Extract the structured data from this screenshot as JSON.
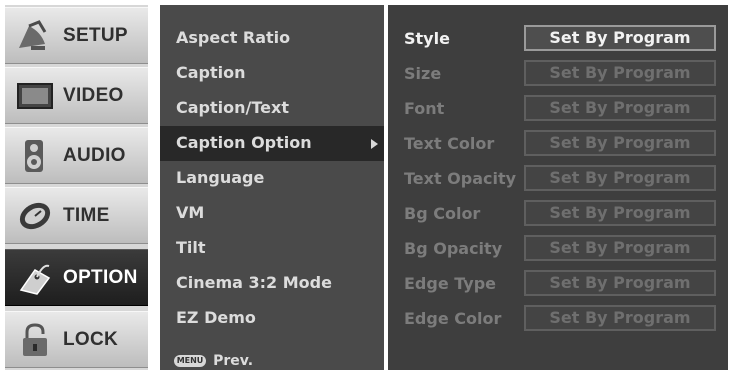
{
  "tabs": [
    {
      "label": "SETUP",
      "icon": "satellite-dish-icon",
      "active": false
    },
    {
      "label": "VIDEO",
      "icon": "monitor-icon",
      "active": false
    },
    {
      "label": "AUDIO",
      "icon": "speaker-icon",
      "active": false
    },
    {
      "label": "TIME",
      "icon": "clock-icon",
      "active": false
    },
    {
      "label": "OPTION",
      "icon": "tag-icon",
      "active": true
    },
    {
      "label": "LOCK",
      "icon": "padlock-icon",
      "active": false
    }
  ],
  "menu": {
    "items": [
      {
        "label": "Aspect Ratio",
        "selected": false
      },
      {
        "label": "Caption",
        "selected": false
      },
      {
        "label": "Caption/Text",
        "selected": false
      },
      {
        "label": "Caption Option",
        "selected": true
      },
      {
        "label": "Language",
        "selected": false
      },
      {
        "label": "VM",
        "selected": false
      },
      {
        "label": "Tilt",
        "selected": false
      },
      {
        "label": "Cinema 3:2 Mode",
        "selected": false
      },
      {
        "label": "EZ Demo",
        "selected": false
      }
    ],
    "prev_key": "MENU",
    "prev_label": "Prev."
  },
  "options": {
    "rows": [
      {
        "label": "Style",
        "value": "Set By Program",
        "active": true
      },
      {
        "label": "Size",
        "value": "Set By Program",
        "active": false
      },
      {
        "label": "Font",
        "value": "Set By Program",
        "active": false
      },
      {
        "label": "Text Color",
        "value": "Set By Program",
        "active": false
      },
      {
        "label": "Text Opacity",
        "value": "Set By Program",
        "active": false
      },
      {
        "label": "Bg Color",
        "value": "Set By Program",
        "active": false
      },
      {
        "label": "Bg Opacity",
        "value": "Set By Program",
        "active": false
      },
      {
        "label": "Edge Type",
        "value": "Set By Program",
        "active": false
      },
      {
        "label": "Edge Color",
        "value": "Set By Program",
        "active": false
      }
    ]
  }
}
